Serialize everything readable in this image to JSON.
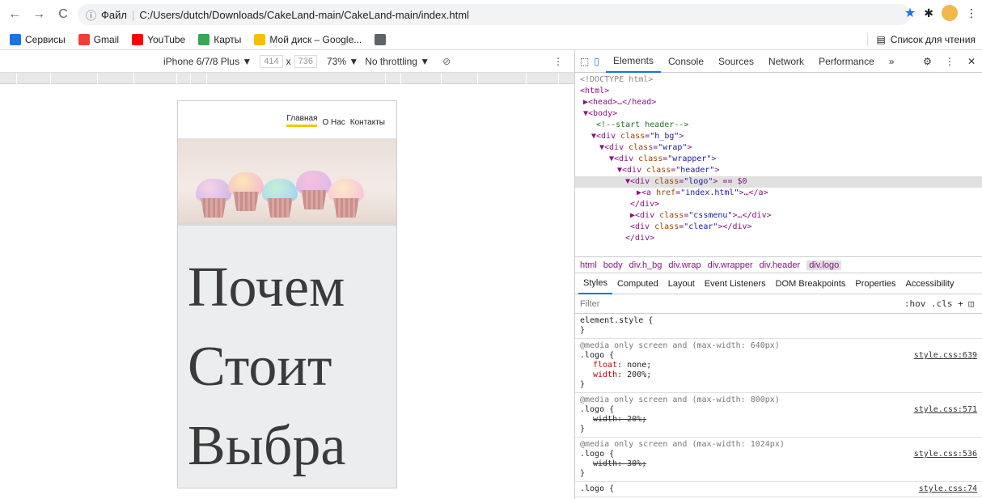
{
  "browser": {
    "url_label": "Файл",
    "url": "C:/Users/dutch/Downloads/CakeLand-main/CakeLand-main/index.html",
    "bookmarks": [
      {
        "label": "Сервисы",
        "color": "#1a73e8"
      },
      {
        "label": "Gmail",
        "color": "#ea4335"
      },
      {
        "label": "YouTube",
        "color": "#ff0000"
      },
      {
        "label": "Карты",
        "color": "#34a853"
      },
      {
        "label": "Мой диск – Google...",
        "color": "#fbbc04"
      },
      {
        "label": "",
        "color": "#5f6368"
      }
    ],
    "reading_list": "Список для чтения"
  },
  "device_toolbar": {
    "device": "iPhone 6/7/8 Plus ▼",
    "width": "414",
    "x": "x",
    "height": "736",
    "zoom": "73% ▼",
    "throttle": "No throttling ▼"
  },
  "page": {
    "nav": [
      "Главная",
      "О Нас",
      "Контакты"
    ],
    "lines": [
      "Почем",
      "Стоит",
      "Выбра"
    ]
  },
  "devtools": {
    "tabs": [
      "Elements",
      "Console",
      "Sources",
      "Network",
      "Performance",
      "»"
    ],
    "dom": [
      "<!DOCTYPE html>",
      "<html>",
      "▶<head>…</head>",
      "▼<body>",
      "<!--start header-->",
      "▼<div class=\"h_bg\">",
      "▼<div class=\"wrap\">",
      "▼<div class=\"wrapper\">",
      "▼<div class=\"header\">",
      "▼<div class=\"logo\"> == $0",
      "▶<a href=\"index.html\">…</a>",
      "</div>",
      "▶<div class=\"cssmenu\">…</div>",
      "<div class=\"clear\"></div>",
      "</div>"
    ],
    "crumbs": [
      "html",
      "body",
      "div.h_bg",
      "div.wrap",
      "div.wrapper",
      "div.header",
      "div.logo"
    ],
    "subtabs": [
      "Styles",
      "Computed",
      "Layout",
      "Event Listeners",
      "DOM Breakpoints",
      "Properties",
      "Accessibility"
    ],
    "filter_placeholder": "Filter",
    "filter_controls": ":hov .cls + ◫",
    "rules": [
      {
        "media": "",
        "selector": "element.style {",
        "props": [],
        "close": "}",
        "src": ""
      },
      {
        "media": "@media only screen and (max-width: 640px)",
        "selector": ".logo {",
        "props": [
          {
            "name": "float",
            "value": "none;",
            "strike": false
          },
          {
            "name": "width",
            "value": "200%;",
            "strike": false
          }
        ],
        "close": "}",
        "src": "style.css:639"
      },
      {
        "media": "@media only screen and (max-width: 800px)",
        "selector": ".logo {",
        "props": [
          {
            "name": "width",
            "value": "20%;",
            "strike": true
          }
        ],
        "close": "}",
        "src": "style.css:571"
      },
      {
        "media": "@media only screen and (max-width: 1024px)",
        "selector": ".logo {",
        "props": [
          {
            "name": "width",
            "value": "30%;",
            "strike": true
          }
        ],
        "close": "}",
        "src": "style.css:536"
      },
      {
        "media": "",
        "selector": ".logo {",
        "props": [],
        "close": "",
        "src": "style.css:74"
      }
    ]
  }
}
